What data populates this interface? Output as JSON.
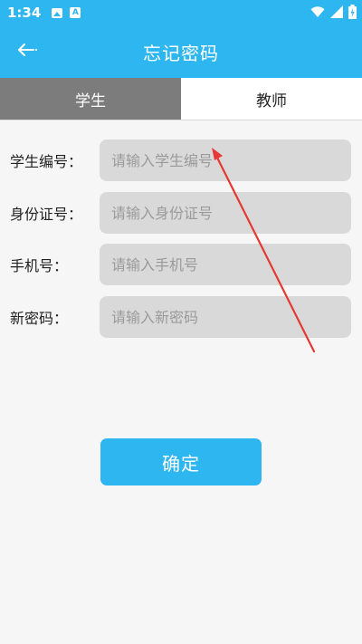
{
  "status_bar": {
    "time": "1:34",
    "icons": [
      "gallery-icon",
      "a-icon",
      "wifi-icon",
      "signal-icon",
      "battery-icon"
    ]
  },
  "app_bar": {
    "title": "忘记密码",
    "back_icon": "arrow-left-icon"
  },
  "tabs": [
    {
      "label": "学生",
      "selected": true
    },
    {
      "label": "教师",
      "selected": false
    }
  ],
  "form": {
    "student_id": {
      "label": "学生编号：",
      "placeholder": "请输入学生编号",
      "value": ""
    },
    "id_card": {
      "label": "身份证号：",
      "placeholder": "请输入身份证号",
      "value": ""
    },
    "phone": {
      "label": "手机号：",
      "placeholder": "请输入手机号",
      "value": ""
    },
    "new_password": {
      "label": "新密码：",
      "placeholder": "请输入新密码",
      "value": ""
    }
  },
  "confirm_label": "确定",
  "colors": {
    "primary": "#2eb6f0",
    "tab_active": "#7c7c7c",
    "input_bg": "#d9d9d9",
    "background": "#f6f6f6",
    "annotation_arrow": "#e53935"
  }
}
